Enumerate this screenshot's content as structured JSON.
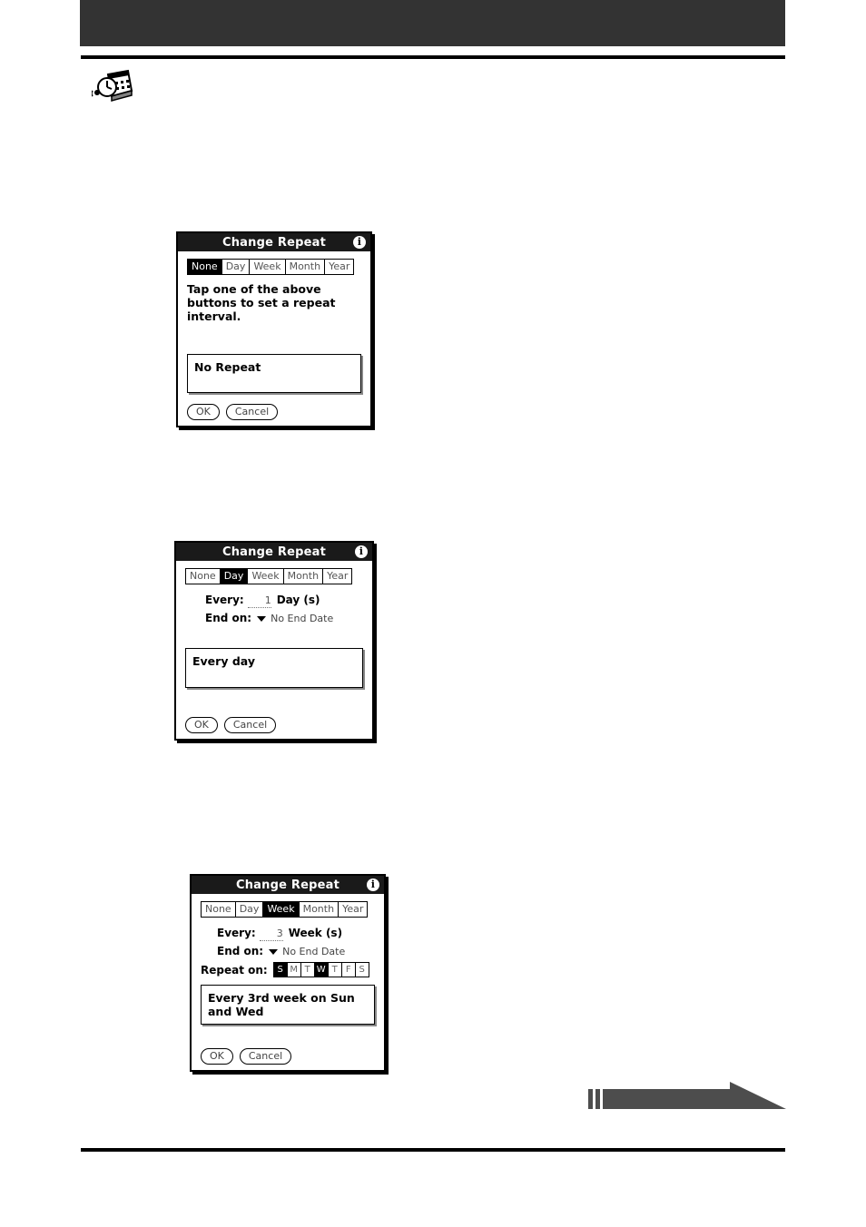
{
  "page": {
    "header_icon": "date-book-icon",
    "nav_arrow_icon": "right-arrow-banner-icon"
  },
  "dialogs": [
    {
      "id": "change-repeat-none",
      "title": "Change Repeat",
      "info_icon": "info-icon",
      "info_glyph": "i",
      "intervals": [
        {
          "label": "None",
          "selected": true
        },
        {
          "label": "Day",
          "selected": false
        },
        {
          "label": "Week",
          "selected": false
        },
        {
          "label": "Month",
          "selected": false
        },
        {
          "label": "Year",
          "selected": false
        }
      ],
      "prose": "Tap one of the above buttons to set a repeat interval.",
      "summary": "No Repeat",
      "buttons": {
        "ok": "OK",
        "cancel": "Cancel"
      }
    },
    {
      "id": "change-repeat-day",
      "title": "Change Repeat",
      "info_icon": "info-icon",
      "info_glyph": "i",
      "intervals": [
        {
          "label": "None",
          "selected": false
        },
        {
          "label": "Day",
          "selected": true
        },
        {
          "label": "Week",
          "selected": false
        },
        {
          "label": "Month",
          "selected": false
        },
        {
          "label": "Year",
          "selected": false
        }
      ],
      "every_label": "Every:",
      "every_value": "1",
      "every_unit": "Day (s)",
      "end_label": "End on:",
      "end_value": "No End Date",
      "summary": "Every day",
      "buttons": {
        "ok": "OK",
        "cancel": "Cancel"
      }
    },
    {
      "id": "change-repeat-week",
      "title": "Change Repeat",
      "info_icon": "info-icon",
      "info_glyph": "i",
      "intervals": [
        {
          "label": "None",
          "selected": false
        },
        {
          "label": "Day",
          "selected": false
        },
        {
          "label": "Week",
          "selected": true
        },
        {
          "label": "Month",
          "selected": false
        },
        {
          "label": "Year",
          "selected": false
        }
      ],
      "every_label": "Every:",
      "every_value": "3",
      "every_unit": "Week (s)",
      "end_label": "End on:",
      "end_value": "No End Date",
      "repeat_on_label": "Repeat on:",
      "days": [
        {
          "label": "S",
          "selected": true
        },
        {
          "label": "M",
          "selected": false
        },
        {
          "label": "T",
          "selected": false
        },
        {
          "label": "W",
          "selected": true
        },
        {
          "label": "T",
          "selected": false
        },
        {
          "label": "F",
          "selected": false
        },
        {
          "label": "S",
          "selected": false
        }
      ],
      "summary": "Every 3rd week on Sun and Wed",
      "buttons": {
        "ok": "OK",
        "cancel": "Cancel"
      }
    }
  ],
  "colors": {
    "header_bar": "#333333",
    "rule": "#000000",
    "dialog_title_bg": "#1a1a1a",
    "selected_bg": "#000000",
    "arrow": "#4d4d4d"
  }
}
